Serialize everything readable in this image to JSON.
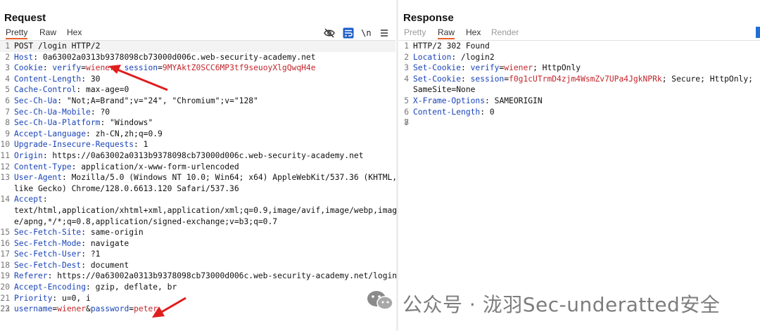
{
  "request": {
    "title": "Request",
    "tabs": [
      "Pretty",
      "Raw",
      "Hex"
    ],
    "active_tab": "Pretty",
    "newline_toggle": "\\n",
    "lines": [
      {
        "n": "1",
        "k": "",
        "sep": "",
        "v": "POST /login HTTP/2",
        "plain": true
      },
      {
        "n": "2",
        "k": "Host",
        "sep": ": ",
        "v": "0a63002a0313b9378098cb73000d006c.web-security-academy.net"
      },
      {
        "n": "3",
        "k": "Cookie",
        "sep": ": ",
        "cookie": [
          {
            "k": "verify",
            "v": "wiener"
          },
          {
            "k": "session",
            "v": "9MYAktZ0SCC6MP3tf9seuoyXlgQwqH4e"
          }
        ]
      },
      {
        "n": "4",
        "k": "Content-Length",
        "sep": ": ",
        "v": "30"
      },
      {
        "n": "5",
        "k": "Cache-Control",
        "sep": ": ",
        "v": "max-age=0"
      },
      {
        "n": "6",
        "k": "Sec-Ch-Ua",
        "sep": ": ",
        "v": "\"Not;A=Brand\";v=\"24\", \"Chromium\";v=\"128\""
      },
      {
        "n": "7",
        "k": "Sec-Ch-Ua-Mobile",
        "sep": ": ",
        "v": "?0"
      },
      {
        "n": "8",
        "k": "Sec-Ch-Ua-Platform",
        "sep": ": ",
        "v": "\"Windows\""
      },
      {
        "n": "9",
        "k": "Accept-Language",
        "sep": ": ",
        "v": "zh-CN,zh;q=0.9"
      },
      {
        "n": "10",
        "k": "Upgrade-Insecure-Requests",
        "sep": ": ",
        "v": "1"
      },
      {
        "n": "11",
        "k": "Origin",
        "sep": ": ",
        "v": "https://0a63002a0313b9378098cb73000d006c.web-security-academy.net"
      },
      {
        "n": "12",
        "k": "Content-Type",
        "sep": ": ",
        "v": "application/x-www-form-urlencoded"
      },
      {
        "n": "13",
        "k": "User-Agent",
        "sep": ": ",
        "v": "Mozilla/5.0 (Windows NT 10.0; Win64; x64) AppleWebKit/537.36 (KHTML,"
      },
      {
        "n": "",
        "k": "",
        "sep": "",
        "v": " like Gecko) Chrome/128.0.6613.120 Safari/537.36",
        "plain": true
      },
      {
        "n": "14",
        "k": "Accept",
        "sep": ":",
        "v": ""
      },
      {
        "n": "",
        "k": "",
        "sep": "",
        "v": "text/html,application/xhtml+xml,application/xml;q=0.9,image/avif,image/webp,imag",
        "plain": true
      },
      {
        "n": "",
        "k": "",
        "sep": "",
        "v": "e/apng,*/*;q=0.8,application/signed-exchange;v=b3;q=0.7",
        "plain": true
      },
      {
        "n": "15",
        "k": "Sec-Fetch-Site",
        "sep": ": ",
        "v": "same-origin"
      },
      {
        "n": "16",
        "k": "Sec-Fetch-Mode",
        "sep": ": ",
        "v": "navigate"
      },
      {
        "n": "17",
        "k": "Sec-Fetch-User",
        "sep": ": ",
        "v": "?1"
      },
      {
        "n": "18",
        "k": "Sec-Fetch-Dest",
        "sep": ": ",
        "v": "document"
      },
      {
        "n": "19",
        "k": "Referer",
        "sep": ": ",
        "v": "https://0a63002a0313b9378098cb73000d006c.web-security-academy.net/login"
      },
      {
        "n": "20",
        "k": "Accept-Encoding",
        "sep": ": ",
        "v": "gzip, deflate, br"
      },
      {
        "n": "21",
        "k": "Priority",
        "sep": ": ",
        "v": "u=0, i"
      },
      {
        "n": "22",
        "k": "",
        "sep": "",
        "v": "",
        "plain": true
      },
      {
        "n": "23",
        "body": [
          {
            "k": "username",
            "v": "wiener"
          },
          {
            "k": "password",
            "v": "peter"
          }
        ]
      }
    ]
  },
  "response": {
    "title": "Response",
    "tabs": [
      "Pretty",
      "Raw",
      "Hex",
      "Render"
    ],
    "active_tab": "Raw",
    "lines": [
      {
        "n": "1",
        "k": "",
        "sep": "",
        "v": "HTTP/2 302 Found",
        "plain": true
      },
      {
        "n": "2",
        "k": "Location",
        "sep": ": ",
        "v": "/login2"
      },
      {
        "n": "3",
        "k": "Set-Cookie",
        "sep": ": ",
        "cookie": [
          {
            "k": "verify",
            "v": "wiener"
          }
        ],
        "tail": "; HttpOnly"
      },
      {
        "n": "4",
        "k": "Set-Cookie",
        "sep": ": ",
        "cookie": [
          {
            "k": "session",
            "v": "f0g1cUTrmD4zjm4WsmZv7UPa4JgkNPRk"
          }
        ],
        "tail": "; Secure; HttpOnly;"
      },
      {
        "n": "",
        "k": "",
        "sep": "",
        "v": "SameSite=None",
        "plain": true
      },
      {
        "n": "5",
        "k": "X-Frame-Options",
        "sep": ": ",
        "v": "SAMEORIGIN"
      },
      {
        "n": "6",
        "k": "Content-Length",
        "sep": ": ",
        "v": "0"
      },
      {
        "n": "7",
        "k": "",
        "sep": "",
        "v": "",
        "plain": true
      },
      {
        "n": "8",
        "k": "",
        "sep": "",
        "v": "",
        "plain": true
      }
    ]
  },
  "watermark": {
    "text": "公众号 · 泷羽Sec-underatted安全",
    "icon": "wechat-icon"
  },
  "icons": {
    "hide": "eye-off-icon",
    "wrap": "wrap-lines-icon",
    "menu": "hamburger-menu-icon"
  },
  "colors": {
    "key": "#1a44b8",
    "value": "#c2262c",
    "accent": "#e8612c",
    "arrow": "#e01e1e"
  }
}
